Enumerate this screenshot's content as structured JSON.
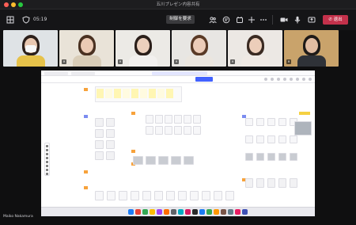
{
  "window": {
    "title": "五川プレゼン内容共有"
  },
  "toolbar": {
    "timer": "05:19",
    "control_label": "制御を要求",
    "leave_label": "退出",
    "icons": [
      "grid-icon",
      "shield-icon",
      "people-icon",
      "chat-icon",
      "reactions-icon",
      "add-icon",
      "more-icon",
      "camera-icon",
      "mic-icon",
      "share-icon"
    ]
  },
  "participants": [
    {
      "bg": "#dfe3e6",
      "hair": "#2b1f1a",
      "skin": "#e8c7b0",
      "shirt": "#e6c24a",
      "mask": true
    },
    {
      "bg": "#e9e3d8",
      "hair": "#4a3121",
      "skin": "#ebcab4",
      "shirt": "#d9cdb8",
      "mask": false
    },
    {
      "bg": "#eceae6",
      "hair": "#2b1f1a",
      "skin": "#ecd0bd",
      "shirt": "#f2f0ee",
      "mask": false
    },
    {
      "bg": "#e8e6e3",
      "hair": "#5a3a26",
      "skin": "#ecccb8",
      "shirt": "#ebe6df",
      "mask": false
    },
    {
      "bg": "#ece8e4",
      "hair": "#3a2a22",
      "skin": "#ecceba",
      "shirt": "#efe9e4",
      "mask": false
    },
    {
      "bg": "#c9a36b",
      "hair": "#1e1a18",
      "skin": "#e2bda3",
      "shirt": "#2f3238",
      "mask": false
    }
  ],
  "presenter": {
    "name": "Maiko Nakamura"
  },
  "colors": {
    "leave": "#c4314b",
    "share_blue": "#4262ff",
    "tag_orange": "#f7a23b",
    "tag_blue": "#7b8cf0"
  }
}
